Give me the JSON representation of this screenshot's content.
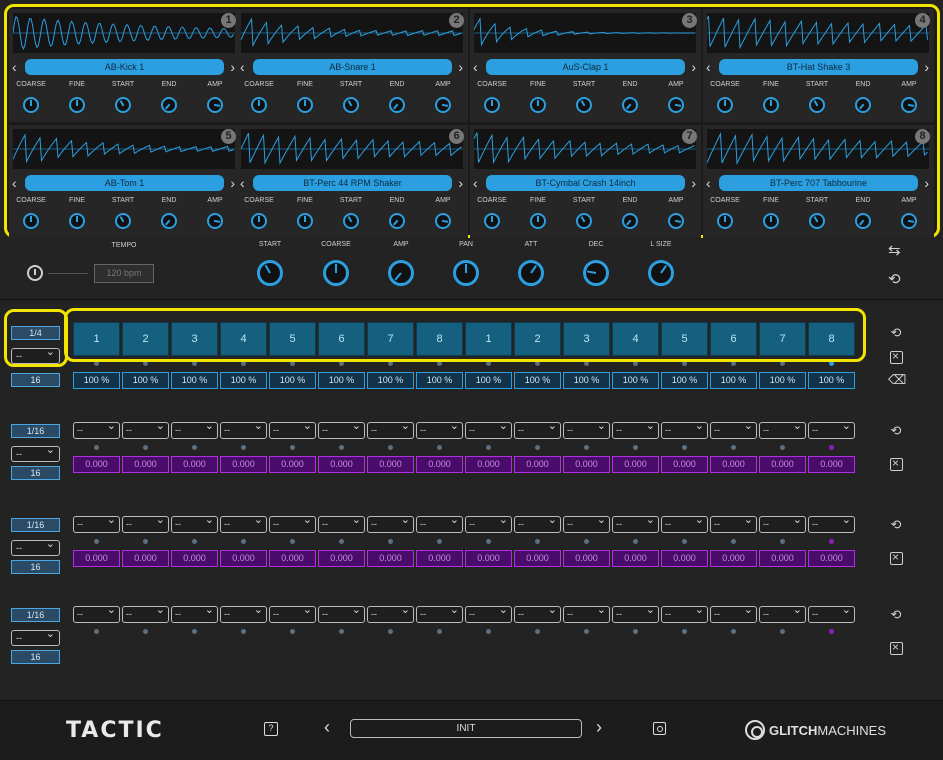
{
  "samples": [
    {
      "number": "1",
      "name": "AB-Kick 1"
    },
    {
      "number": "2",
      "name": "AB-Snare 1"
    },
    {
      "number": "3",
      "name": "AuS-Clap 1"
    },
    {
      "number": "4",
      "name": "BT-Hat Shake 3"
    },
    {
      "number": "5",
      "name": "AB-Tom 1"
    },
    {
      "number": "6",
      "name": "BT-Perc 44 RPM Shaker"
    },
    {
      "number": "7",
      "name": "BT-Cymbal Crash 14inch"
    },
    {
      "number": "8",
      "name": "BT-Perc 707 Tabbourine"
    }
  ],
  "sample_knob_labels": [
    "COARSE",
    "FINE",
    "START",
    "END",
    "AMP"
  ],
  "global": {
    "tempo_label": "TEMPO",
    "tempo_value": "120 bpm",
    "knob_labels": [
      "START",
      "COARSE",
      "AMP",
      "PAN",
      "ATT",
      "DEC",
      "L SIZE"
    ]
  },
  "sequencer": {
    "rows": [
      {
        "rate": "1/4",
        "dropdown": "--",
        "length": "16",
        "steps": [
          "1",
          "2",
          "3",
          "4",
          "5",
          "6",
          "7",
          "8",
          "1",
          "2",
          "3",
          "4",
          "5",
          "6",
          "7",
          "8"
        ],
        "values": [
          "100 %",
          "100 %",
          "100 %",
          "100 %",
          "100 %",
          "100 %",
          "100 %",
          "100 %",
          "100 %",
          "100 %",
          "100 %",
          "100 %",
          "100 %",
          "100 %",
          "100 %",
          "100 %"
        ]
      },
      {
        "rate": "1/16",
        "dropdown": "--",
        "length": "16",
        "steps": [
          "--",
          "--",
          "--",
          "--",
          "--",
          "--",
          "--",
          "--",
          "--",
          "--",
          "--",
          "--",
          "--",
          "--",
          "--",
          "--"
        ],
        "values": [
          "0.000",
          "0.000",
          "0.000",
          "0.000",
          "0.000",
          "0.000",
          "0.000",
          "0.000",
          "0.000",
          "0.000",
          "0.000",
          "0.000",
          "0.000",
          "0.000",
          "0.000",
          "0.000"
        ]
      },
      {
        "rate": "1/16",
        "dropdown": "--",
        "length": "16",
        "steps": [
          "--",
          "--",
          "--",
          "--",
          "--",
          "--",
          "--",
          "--",
          "--",
          "--",
          "--",
          "--",
          "--",
          "--",
          "--",
          "--"
        ],
        "values": [
          "0.000",
          "0.000",
          "0.000",
          "0.000",
          "0.000",
          "0.000",
          "0.000",
          "0.000",
          "0.000",
          "0.000",
          "0.000",
          "0.000",
          "0.000",
          "0.000",
          "0.000",
          "0.000"
        ]
      },
      {
        "rate": "1/16",
        "dropdown": "--",
        "length": "16",
        "steps": [
          "--",
          "--",
          "--",
          "--",
          "--",
          "--",
          "--",
          "--",
          "--",
          "--",
          "--",
          "--",
          "--",
          "--",
          "--",
          "--"
        ],
        "values": []
      }
    ],
    "active_step_index": 15
  },
  "footer": {
    "logo": "TACTIC",
    "help_label": "?",
    "preset_name": "INIT",
    "brand_bold": "GLITCH",
    "brand_light": "MACHINES"
  },
  "colors": {
    "accent": "#2b9fe0",
    "purple": "#8a1fc0",
    "highlight": "#f2e600"
  }
}
